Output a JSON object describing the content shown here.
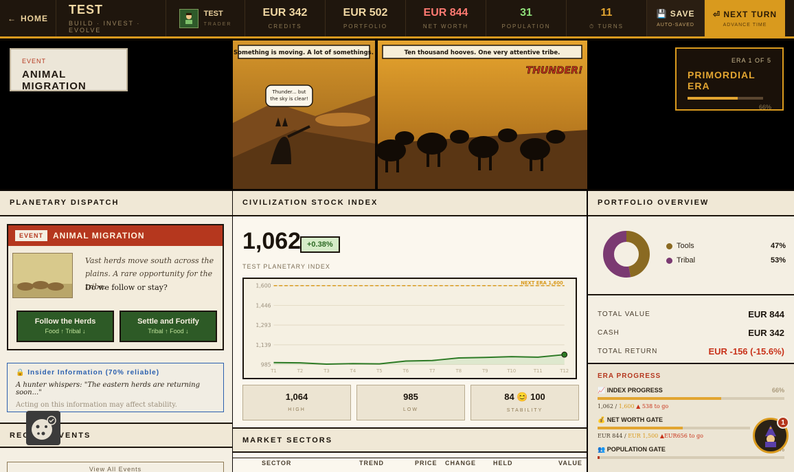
{
  "topbar": {
    "home_label": "HOME",
    "brand_title": "TEST",
    "brand_tagline": "BUILD · INVEST · EVOLVE",
    "trader_name": "TEST",
    "trader_role": "TRADER",
    "stats": [
      {
        "value": "EUR 342",
        "label": "CREDITS",
        "color": "#f0d7a3"
      },
      {
        "value": "EUR 502",
        "label": "PORTFOLIO",
        "color": "#f0d7a3"
      },
      {
        "value": "EUR 844",
        "label": "NET WORTH",
        "color": "#ff7a72"
      },
      {
        "value": "31",
        "label": "POPULATION",
        "color": "#8fe07a"
      },
      {
        "value": "11",
        "label": "TURNS",
        "color": "#e2a531"
      }
    ],
    "save_label": "SAVE",
    "save_sub": "AUTO-SAVED",
    "next_label": "NEXT TURN",
    "next_sub": "ADVANCE TIME"
  },
  "hero": {
    "event_kicker": "EVENT",
    "event_title": "ANIMAL MIGRATION",
    "caption_left": "Something is moving. A lot of somethings.",
    "bubble": "Thunder... but the sky is clear!",
    "caption_right": "Ten thousand hooves. One very attentive tribe.",
    "sfx": "THUNDER!",
    "era_kicker": "ERA 1 OF 5",
    "era_title": "PRIMORDIAL ERA",
    "era_progress": 66,
    "era_progress_label": "66%"
  },
  "dispatch": {
    "header": "PLANETARY DISPATCH",
    "tag": "EVENT",
    "title": "ANIMAL MIGRATION",
    "text": "Vast herds move south across the plains. A rare opportunity for the tribe.",
    "question": "Do we follow or stay?",
    "choices": [
      {
        "label": "Follow the Herds",
        "effect": "Food ↑ Tribal ↓"
      },
      {
        "label": "Settle and Fortify",
        "effect": "Tribal ↑ Food ↓"
      }
    ],
    "insider_header": "Insider Information (70% reliable)",
    "insider_quote": "A hunter whispers: \"The eastern herds are returning soon...\"",
    "insider_note": "Acting on this information may affect stability.",
    "recent_header": "RECENT EVENTS",
    "view_all": "View All Events"
  },
  "index": {
    "header": "CIVILIZATION STOCK INDEX",
    "value": "1,062",
    "change": "+0.38%",
    "label": "TEST PLANETARY INDEX",
    "stats": [
      {
        "value": "1,064",
        "label": "HIGH"
      },
      {
        "value": "985",
        "label": "LOW"
      },
      {
        "value": "84 😊 100",
        "label": "STABILITY"
      }
    ]
  },
  "chart_data": {
    "type": "area",
    "x": [
      "T1",
      "T2",
      "T3",
      "T4",
      "T5",
      "T6",
      "T7",
      "T8",
      "T9",
      "T10",
      "T11",
      "T12"
    ],
    "y": [
      1000,
      998,
      988,
      992,
      990,
      1012,
      1016,
      1036,
      1040,
      1046,
      1042,
      1062
    ],
    "yticks": [
      "1,600",
      "1,446",
      "1,293",
      "1,139",
      "985"
    ],
    "ylim": [
      985,
      1600
    ],
    "threshold": 1600,
    "threshold_label": "NEXT ERA 1,600",
    "line_color": "#2d7a25"
  },
  "sectors": {
    "header": "MARKET SECTORS",
    "columns": [
      "SECTOR",
      "TREND",
      "PRICE",
      "CHANGE",
      "HELD",
      "VALUE"
    ]
  },
  "portfolio": {
    "header": "PORTFOLIO OVERVIEW",
    "slices": [
      {
        "name": "Tools",
        "percent": 47,
        "label": "47%",
        "color": "#8a6a22"
      },
      {
        "name": "Tribal",
        "percent": 53,
        "label": "53%",
        "color": "#7b3a72"
      }
    ],
    "total_value_label": "TOTAL VALUE",
    "total_value": "EUR 844",
    "cash_label": "CASH",
    "cash": "EUR 342",
    "total_return_label": "TOTAL RETURN",
    "total_return": "EUR -156 (-15.6%)"
  },
  "era_progress": {
    "header": "ERA PROGRESS",
    "items": [
      {
        "name": "INDEX PROGRESS",
        "pct": 66,
        "pct_label": "66%",
        "current": "1,062",
        "target": "1,600",
        "togo": "▲ 538 to go",
        "color": "#e2a531"
      },
      {
        "name": "NET WORTH GATE",
        "pct": 56,
        "pct_label": "",
        "current": "EUR 844",
        "target": "EUR 1,500",
        "togo": "▲EUR656 to go",
        "color": "#e2a531"
      },
      {
        "name": "POPULATION GATE",
        "pct": 1,
        "pct_label": "1%",
        "color": "#b5371e"
      }
    ]
  },
  "helper_badge": "1"
}
